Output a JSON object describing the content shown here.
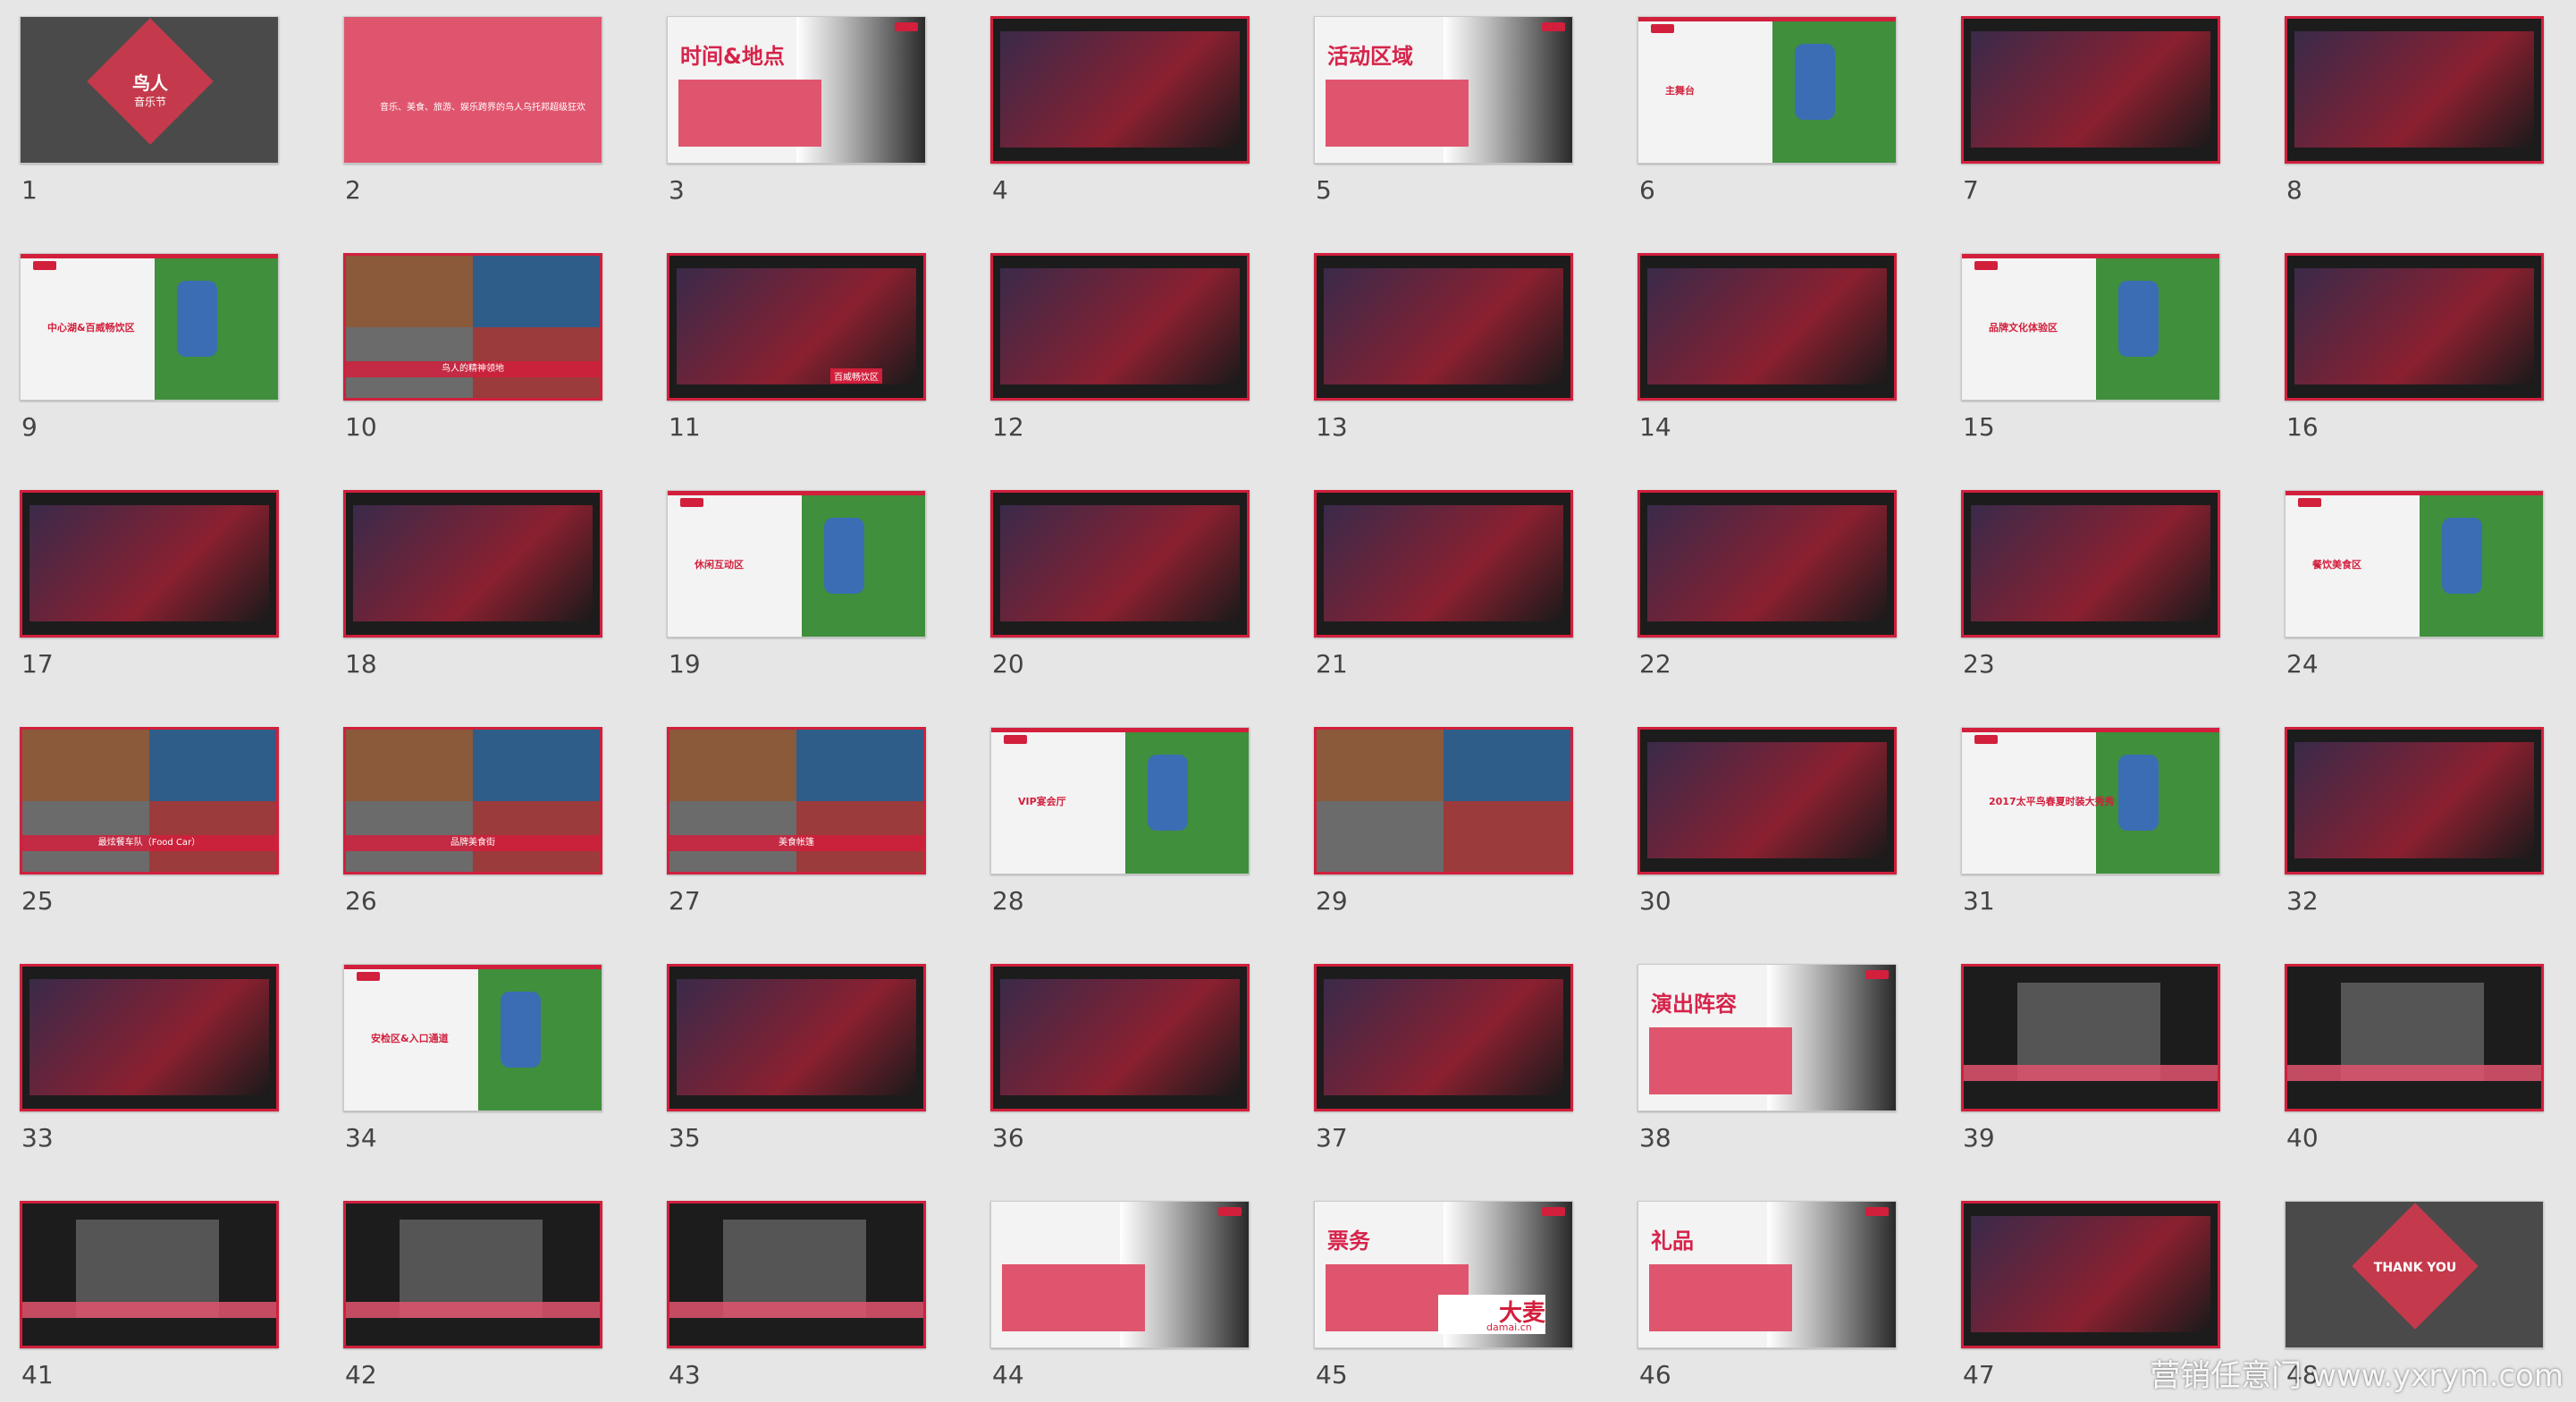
{
  "slides": [
    {
      "n": "1",
      "style": "gray",
      "texts": [
        "鸟人",
        "音乐节"
      ]
    },
    {
      "n": "2",
      "style": "pink",
      "texts": [
        "音乐、美食、旅游、娱乐跨界的鸟人乌托邦超级狂欢"
      ]
    },
    {
      "n": "3",
      "style": "crowd",
      "texts": [
        "时间&地点"
      ]
    },
    {
      "n": "4",
      "style": "dark",
      "texts": []
    },
    {
      "n": "5",
      "style": "crowd",
      "texts": [
        "活动区域"
      ]
    },
    {
      "n": "6",
      "style": "map",
      "texts": [
        "主舞台"
      ]
    },
    {
      "n": "7",
      "style": "dark",
      "texts": []
    },
    {
      "n": "8",
      "style": "dark",
      "texts": []
    },
    {
      "n": "9",
      "style": "map",
      "texts": [
        "中心湖&百威畅饮区"
      ]
    },
    {
      "n": "10",
      "style": "photo",
      "texts": [
        "鸟人的精神领地"
      ]
    },
    {
      "n": "11",
      "style": "dark",
      "texts": [
        "百威畅饮区"
      ]
    },
    {
      "n": "12",
      "style": "dark",
      "texts": []
    },
    {
      "n": "13",
      "style": "dark",
      "texts": []
    },
    {
      "n": "14",
      "style": "dark",
      "texts": []
    },
    {
      "n": "15",
      "style": "map",
      "texts": [
        "品牌文化体验区"
      ]
    },
    {
      "n": "16",
      "style": "dark",
      "texts": []
    },
    {
      "n": "17",
      "style": "dark",
      "texts": []
    },
    {
      "n": "18",
      "style": "dark",
      "texts": []
    },
    {
      "n": "19",
      "style": "map",
      "texts": [
        "休闲互动区"
      ]
    },
    {
      "n": "20",
      "style": "dark",
      "texts": []
    },
    {
      "n": "21",
      "style": "dark",
      "texts": []
    },
    {
      "n": "22",
      "style": "dark",
      "texts": []
    },
    {
      "n": "23",
      "style": "dark",
      "texts": []
    },
    {
      "n": "24",
      "style": "map",
      "texts": [
        "餐饮美食区"
      ]
    },
    {
      "n": "25",
      "style": "photo",
      "texts": [
        "最炫餐车队（Food Car）"
      ]
    },
    {
      "n": "26",
      "style": "photo",
      "texts": [
        "品牌美食街"
      ]
    },
    {
      "n": "27",
      "style": "photo",
      "texts": [
        "美食帐篷"
      ]
    },
    {
      "n": "28",
      "style": "map",
      "texts": [
        "VIP宴会厅"
      ]
    },
    {
      "n": "29",
      "style": "photo",
      "texts": []
    },
    {
      "n": "30",
      "style": "dark",
      "texts": []
    },
    {
      "n": "31",
      "style": "map",
      "texts": [
        "2017太平鸟春夏时装大秀秀"
      ]
    },
    {
      "n": "32",
      "style": "dark",
      "texts": []
    },
    {
      "n": "33",
      "style": "dark",
      "texts": []
    },
    {
      "n": "34",
      "style": "map",
      "texts": [
        "安检区&入口通道"
      ]
    },
    {
      "n": "35",
      "style": "dark",
      "texts": []
    },
    {
      "n": "36",
      "style": "dark",
      "texts": []
    },
    {
      "n": "37",
      "style": "dark",
      "texts": []
    },
    {
      "n": "38",
      "style": "crowd",
      "texts": [
        "演出阵容"
      ]
    },
    {
      "n": "39",
      "style": "graybanner",
      "texts": []
    },
    {
      "n": "40",
      "style": "graybanner",
      "texts": []
    },
    {
      "n": "41",
      "style": "graybanner",
      "texts": []
    },
    {
      "n": "42",
      "style": "graybanner",
      "texts": []
    },
    {
      "n": "43",
      "style": "graybanner",
      "texts": []
    },
    {
      "n": "44",
      "style": "crowd",
      "texts": []
    },
    {
      "n": "45",
      "style": "crowd",
      "texts": [
        "票务",
        "大麦",
        "damai.cn"
      ]
    },
    {
      "n": "46",
      "style": "crowd",
      "texts": [
        "礼品"
      ]
    },
    {
      "n": "47",
      "style": "dark",
      "texts": []
    },
    {
      "n": "48",
      "style": "gray",
      "texts": [
        "THANK YOU"
      ]
    }
  ],
  "watermark": "营销任意门 www.yxrym.com"
}
